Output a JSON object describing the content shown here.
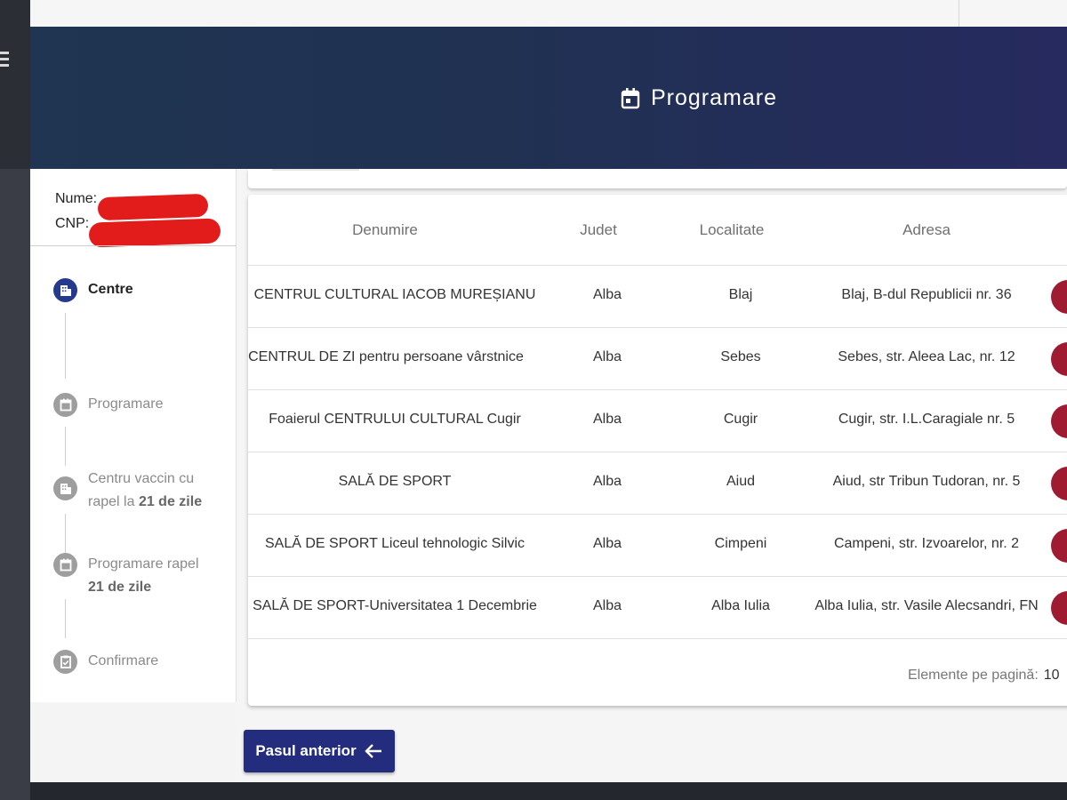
{
  "header": {
    "title": "Programare",
    "icon": "calendar-icon"
  },
  "user": {
    "name_label": "Nume:",
    "cnp_label": "CNP:"
  },
  "steps": [
    {
      "label": "Centre",
      "icon": "building-icon",
      "active": true
    },
    {
      "label": "Programare",
      "icon": "calendar-icon",
      "active": false
    },
    {
      "label_line1": "Centru vaccin cu",
      "label_line2_pre": "rapel la",
      "label_line2_bold": "21 de zile",
      "icon": "building-icon",
      "active": false
    },
    {
      "label_line1": "Programare rapel",
      "label_line2_bold": "21 de zile",
      "icon": "calendar-icon",
      "active": false
    },
    {
      "label": "Confirmare",
      "icon": "checklist-icon",
      "active": false
    }
  ],
  "table": {
    "headers": {
      "name": "Denumire",
      "county": "Judet",
      "city": "Localitate",
      "address": "Adresa"
    },
    "rows": [
      {
        "name": "CENTRUL CULTURAL IACOB MUREȘIANU",
        "county": "Alba",
        "city": "Blaj",
        "address": "Blaj, B-dul Republicii nr. 36"
      },
      {
        "name": "CENTRUL DE ZI pentru persoane vârstnice",
        "county": "Alba",
        "city": "Sebes",
        "address": "Sebes, str. Aleea Lac, nr. 12"
      },
      {
        "name": "Foaierul CENTRULUI CULTURAL Cugir",
        "county": "Alba",
        "city": "Cugir",
        "address": "Cugir, str. I.L.Caragiale nr. 5"
      },
      {
        "name": "SALĂ DE SPORT",
        "county": "Alba",
        "city": "Aiud",
        "address": "Aiud, str Tribun Tudoran, nr. 5"
      },
      {
        "name": "SALĂ DE SPORT Liceul tehnologic Silvic",
        "county": "Alba",
        "city": "Cimpeni",
        "address": "Campeni, str. Izvoarelor, nr. 2"
      },
      {
        "name": "SALĂ DE SPORT-Universitatea 1 Decembrie",
        "county": "Alba",
        "city": "Alba Iulia",
        "address": "Alba Iulia, str. Vasile Alecsandri, FN"
      }
    ],
    "pager": {
      "label": "Elemente pe pagină:",
      "value": "10"
    }
  },
  "buttons": {
    "prev_label": "Pasul anterior"
  },
  "colors": {
    "primary": "#232c7d",
    "header_start": "#1f3551",
    "header_end": "#262a5e",
    "action_red": "#9e1b32",
    "redaction": "#e21b1b"
  }
}
